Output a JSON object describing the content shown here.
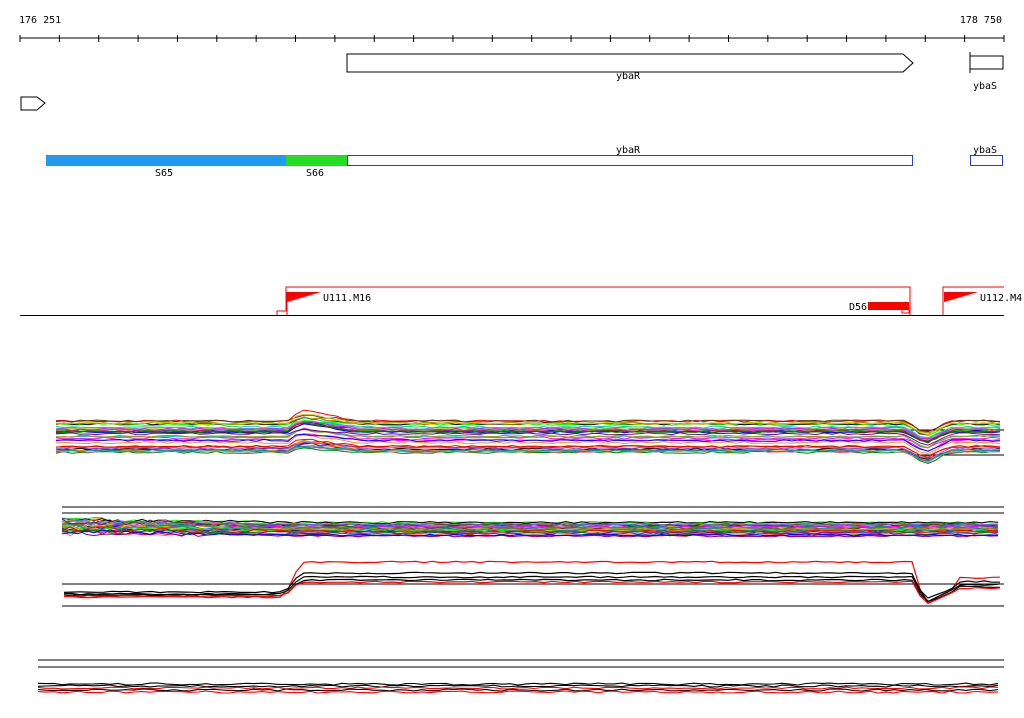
{
  "ruler": {
    "start_label": "176 251",
    "end_label": "178 750",
    "tick_count": 26
  },
  "genes": [
    {
      "id": "ybaR",
      "label": "ybaR",
      "strand": "+"
    },
    {
      "id": "ybaS",
      "label": "ybaS",
      "strand": "+"
    },
    {
      "id": "left",
      "label": "",
      "strand": "+"
    }
  ],
  "segments": [
    {
      "id": "S65",
      "label": "S65",
      "color": "#1e9bf0"
    },
    {
      "id": "S66",
      "label": "S66",
      "color": "#22dd22"
    },
    {
      "id": "ybaR",
      "label": "ybaR",
      "color": "#1f3fcc"
    },
    {
      "id": "ybaS",
      "label": "ybaS",
      "color": "#1f3fcc"
    }
  ],
  "transcripts": [
    {
      "id": "U111.M16",
      "label": "U111.M16",
      "color": "#ff0000"
    },
    {
      "id": "U112.M4",
      "label": "U112.M4",
      "color": "#ff0000"
    },
    {
      "id": "D56",
      "label": "D56",
      "color": "#ff0000"
    }
  ],
  "colors": {
    "trace_palette": [
      "#ff0000",
      "#008000",
      "#0000ff",
      "#ff00ff",
      "#00cccc",
      "#ff9900",
      "#800080",
      "#000000",
      "#999900",
      "#00ff00",
      "#ff6699",
      "#663300",
      "#6666ff",
      "#cccc00",
      "#009999"
    ]
  },
  "icons": {
    "gene_arrow": "arrow-right-shape",
    "transcript_flag": "flag-icon"
  }
}
